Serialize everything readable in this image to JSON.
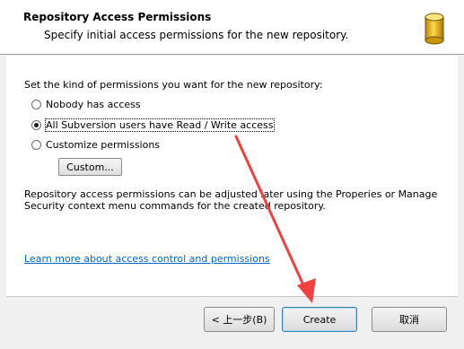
{
  "header": {
    "title": "Repository Access Permissions",
    "subtitle": "Specify initial access permissions for the new repository."
  },
  "body": {
    "instruction": "Set the kind of permissions you want for the new repository:",
    "options": [
      {
        "label": "Nobody has access",
        "checked": false
      },
      {
        "label": "All Subversion users have Read / Write access",
        "checked": true
      },
      {
        "label": "Customize permissions",
        "checked": false
      }
    ],
    "custom_button": "Custom...",
    "note": "Repository access permissions can be adjusted later using the Properies or Manage Security context menu commands for the created repository.",
    "link": "Learn more about access control and permissions"
  },
  "footer": {
    "back_label": "< 上一步(B)",
    "create_label": "Create",
    "cancel_label": "取消"
  },
  "colors": {
    "arrow": "#f04040",
    "link": "#0066cc",
    "icon": "#e8b800"
  }
}
